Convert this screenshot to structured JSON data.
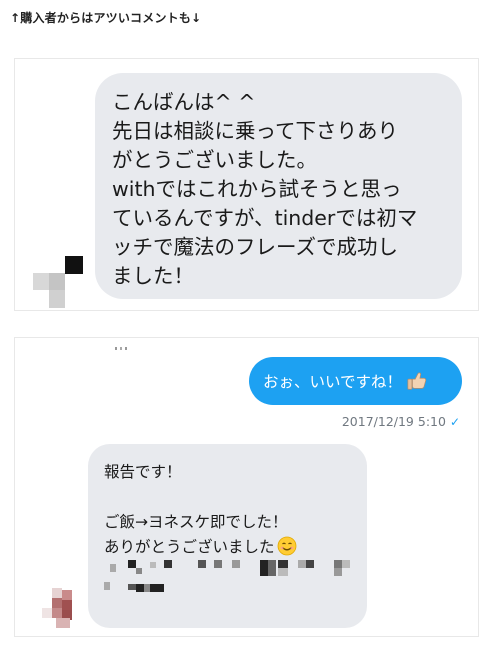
{
  "heading": "↑購入者からはアツいコメントも↓",
  "message1": {
    "lines": [
      "こんばんは^ ^",
      "先日は相談に乗って下さりあり",
      "がとうございました。",
      "withではこれから試そうと思っ",
      "ているんですが、tinderでは初マ",
      "ッチで魔法のフレーズで成功し",
      "ました！"
    ]
  },
  "reply": {
    "text": "おぉ、いいですね！",
    "emoji_icon": "thumbs-up-icon",
    "timestamp": "2017/12/19 5:10",
    "read_icon": "check-icon"
  },
  "message2": {
    "line1": "報告です！",
    "line2": "",
    "line3": "ご飯→ヨネスケ即でした！",
    "line4": "ありがとうございました",
    "emoji_icon": "smiling-face-icon"
  },
  "colors": {
    "sent_bubble": "#1da1f2",
    "received_bubble": "#e8eaee",
    "timestamp": "#707880"
  }
}
